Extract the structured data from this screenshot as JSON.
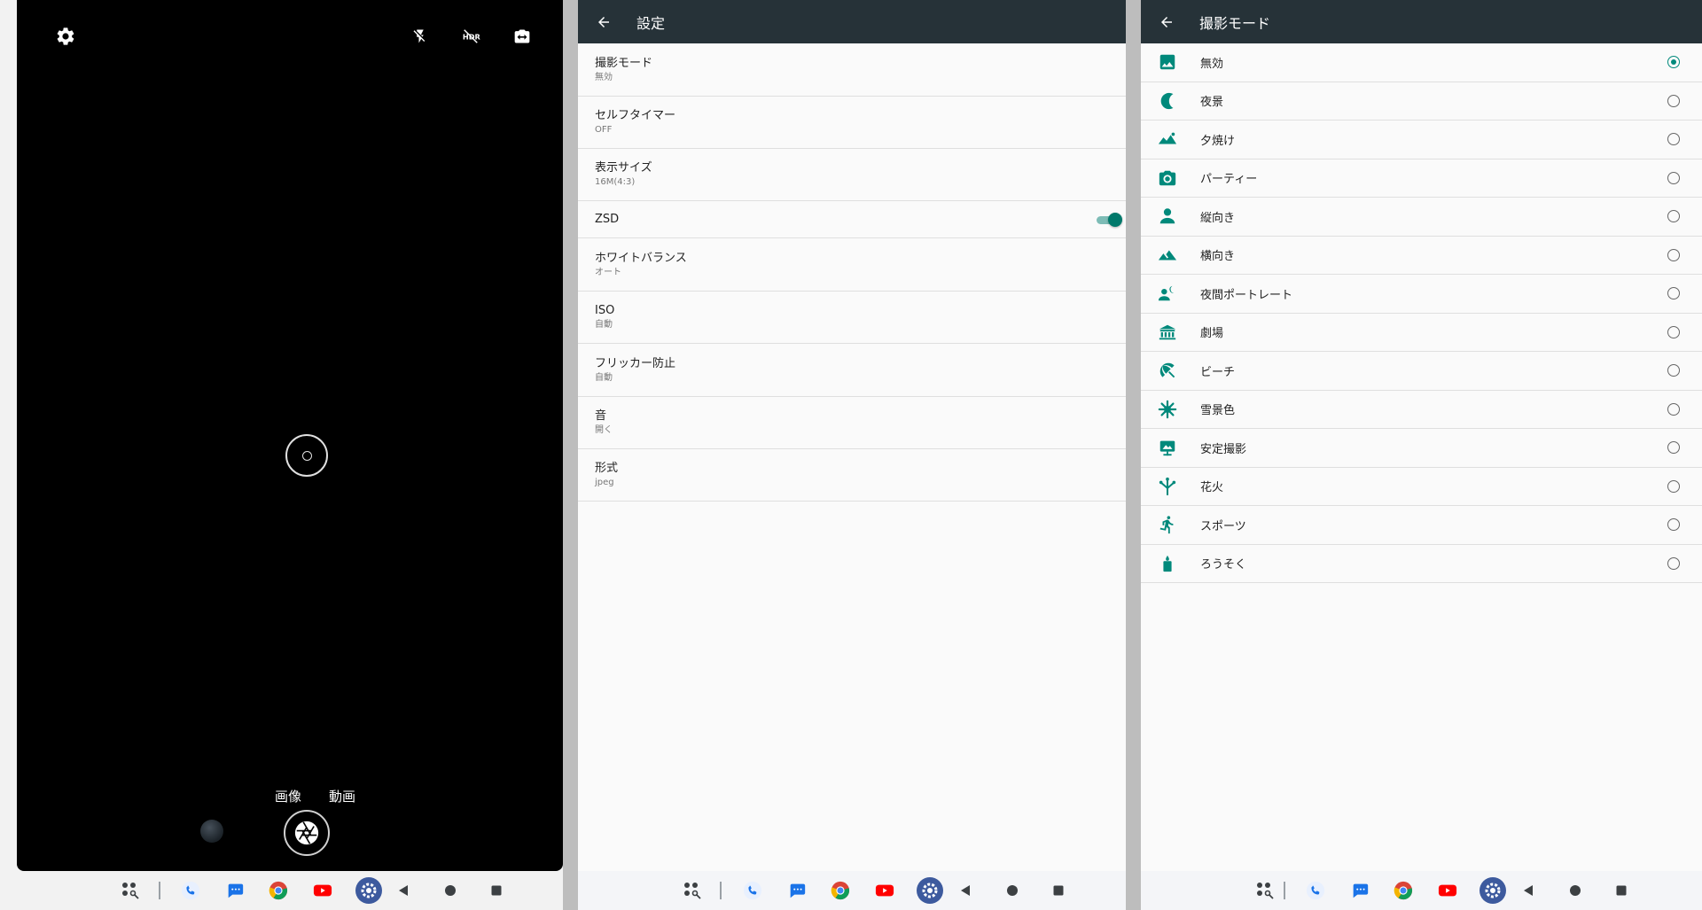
{
  "camera": {
    "modes": [
      "画像",
      "動画"
    ],
    "icons": [
      "gear-icon",
      "flash-off-icon",
      "hdr-off-icon",
      "switch-camera-icon",
      "shutter-icon"
    ]
  },
  "settings": {
    "title": "設定",
    "items": [
      {
        "title": "撮影モード",
        "value": "無効"
      },
      {
        "title": "セルフタイマー",
        "value": "OFF"
      },
      {
        "title": "表示サイズ",
        "value": "16M(4:3)"
      },
      {
        "title": "ZSD",
        "value": ""
      },
      {
        "title": "ホワイトバランス",
        "value": "オート"
      },
      {
        "title": "ISO",
        "value": "自動"
      },
      {
        "title": "フリッカー防止",
        "value": "自動"
      },
      {
        "title": "音",
        "value": "開く"
      },
      {
        "title": "形式",
        "value": "jpeg"
      }
    ],
    "zsd_enabled": true
  },
  "scene_mode": {
    "title": "撮影モード",
    "selected": "無効",
    "items": [
      {
        "label": "無効",
        "icon": "landscape-photo-icon"
      },
      {
        "label": "夜景",
        "icon": "moon-icon"
      },
      {
        "label": "夕焼け",
        "icon": "sunset-mountains-icon"
      },
      {
        "label": "パーティー",
        "icon": "party-camera-icon"
      },
      {
        "label": "縦向き",
        "icon": "portrait-person-icon"
      },
      {
        "label": "横向き",
        "icon": "landscape-mountains-icon"
      },
      {
        "label": "夜間ポートレート",
        "icon": "night-portrait-icon"
      },
      {
        "label": "劇場",
        "icon": "theater-icon"
      },
      {
        "label": "ビーチ",
        "icon": "beach-umbrella-icon"
      },
      {
        "label": "雪景色",
        "icon": "snowflake-icon"
      },
      {
        "label": "安定撮影",
        "icon": "steady-shot-icon"
      },
      {
        "label": "花火",
        "icon": "fireworks-icon"
      },
      {
        "label": "スポーツ",
        "icon": "running-icon"
      },
      {
        "label": "ろうそく",
        "icon": "candle-icon"
      }
    ]
  },
  "taskbar": {
    "items": [
      "app-drawer-icon",
      "phone-icon",
      "messages-icon",
      "chrome-icon",
      "youtube-icon",
      "settings-app-icon",
      "back-icon",
      "home-icon",
      "recents-icon"
    ]
  },
  "colors": {
    "accent": "#00897b",
    "appbar": "#263238",
    "camera_bg": "#000000"
  }
}
